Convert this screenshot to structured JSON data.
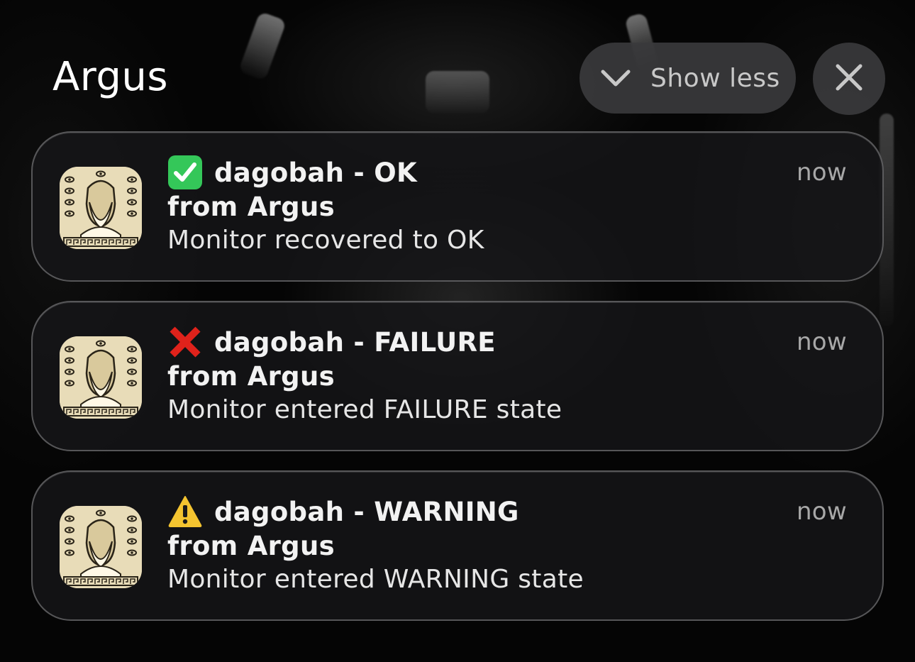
{
  "header": {
    "app_name": "Argus",
    "show_less_label": "Show less",
    "show_less_icon": "chevron-down-icon",
    "close_icon": "close-icon"
  },
  "colors": {
    "ok_green": "#34c759",
    "failure_red": "#e0221b",
    "warning_yellow": "#f4c430",
    "card_bg": "#161618",
    "pill_bg": "#3a3a3c",
    "icon_bg": "#e8dcb8"
  },
  "notifications": [
    {
      "status_icon": "check-mark-button-icon",
      "title": "dagobah - OK",
      "subtitle": "from Argus",
      "body": "Monitor recovered to OK",
      "time": "now"
    },
    {
      "status_icon": "cross-mark-icon",
      "title": "dagobah - FAILURE",
      "subtitle": "from Argus",
      "body": "Monitor entered FAILURE state",
      "time": "now"
    },
    {
      "status_icon": "warning-icon",
      "title": "dagobah - WARNING",
      "subtitle": "from Argus",
      "body": "Monitor entered WARNING state",
      "time": "now"
    }
  ]
}
